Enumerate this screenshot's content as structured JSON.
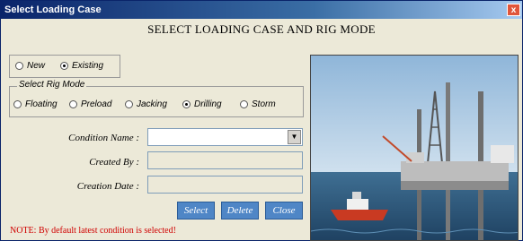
{
  "window": {
    "title": "Select Loading Case",
    "close_glyph": "x"
  },
  "heading": "SELECT LOADING CASE AND RIG MODE",
  "case_options": [
    {
      "label": "New",
      "selected": false
    },
    {
      "label": "Existing",
      "selected": true
    }
  ],
  "rig_mode": {
    "group_label": "Select Rig Mode",
    "options": [
      {
        "label": "Floating",
        "selected": false
      },
      {
        "label": "Preload",
        "selected": false
      },
      {
        "label": "Jacking",
        "selected": false
      },
      {
        "label": "Drilling",
        "selected": true
      },
      {
        "label": "Storm",
        "selected": false
      }
    ]
  },
  "form": {
    "condition_name_label": "Condition Name :",
    "condition_name_value": "",
    "created_by_label": "Created By :",
    "created_by_value": "",
    "creation_date_label": "Creation Date :",
    "creation_date_value": ""
  },
  "buttons": {
    "select": "Select",
    "delete": "Delete",
    "close": "Close"
  },
  "note": "NOTE: By default latest condition is selected!",
  "colors": {
    "note": "#D00000",
    "button": "#4F86C6",
    "title_bar": "#0A246A"
  },
  "icons": {
    "dropdown": "chevron-down-icon",
    "close": "close-icon"
  }
}
